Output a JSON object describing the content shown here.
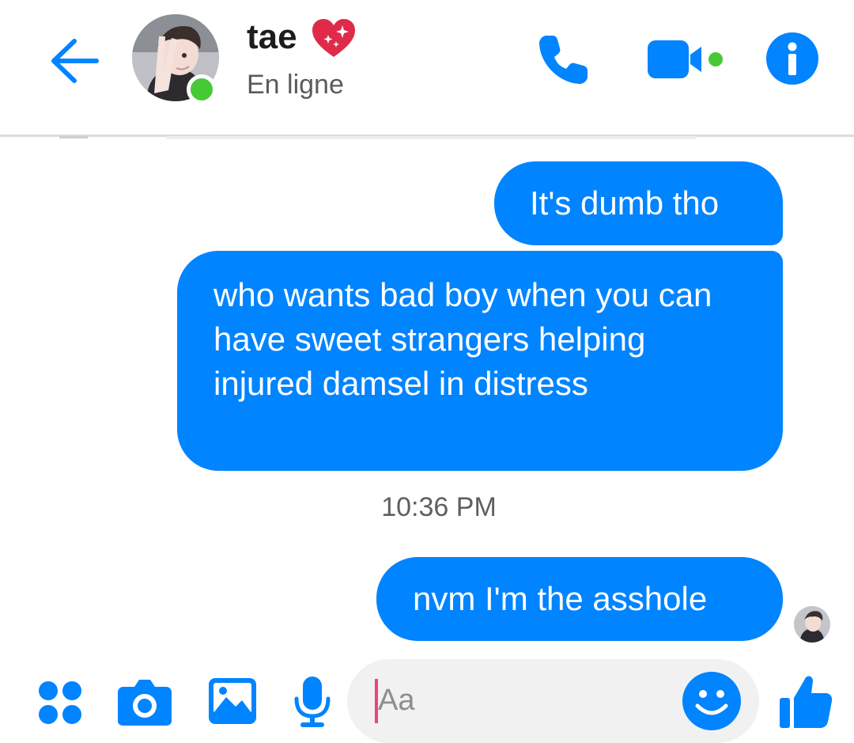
{
  "header": {
    "contact_name": "tae",
    "status": "En ligne",
    "icons": {
      "back": "arrow-left-icon",
      "heart": "sparkling-heart-icon",
      "call": "phone-icon",
      "video": "video-camera-icon",
      "info": "info-icon"
    }
  },
  "messages": [
    {
      "sender": "me",
      "text": "It's dumb tho"
    },
    {
      "sender": "me",
      "text": "who wants bad boy when you can have sweet strangers helping injured damsel in distress"
    }
  ],
  "timestamp": "10:36 PM",
  "last_message": {
    "sender": "me",
    "text": "nvm I'm the asshole",
    "seen": true
  },
  "composer": {
    "placeholder": "Aa",
    "icons": [
      "apps-icon",
      "camera-icon",
      "gallery-icon",
      "microphone-icon",
      "emoji-icon",
      "thumbs-up-icon"
    ]
  },
  "colors": {
    "accent": "#0084ff",
    "online": "#47c936",
    "heart": "#e02a4a",
    "cursor": "#e8477a"
  }
}
